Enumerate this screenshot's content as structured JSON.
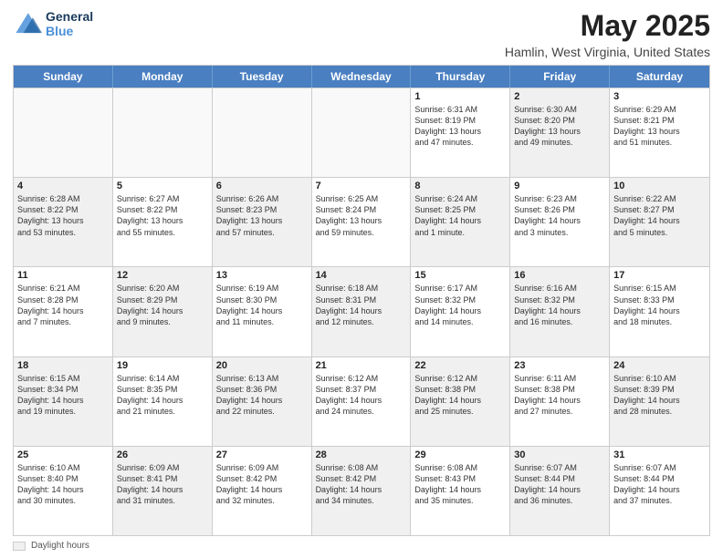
{
  "logo": {
    "line1": "General",
    "line2": "Blue"
  },
  "title": "May 2025",
  "subtitle": "Hamlin, West Virginia, United States",
  "weekdays": [
    "Sunday",
    "Monday",
    "Tuesday",
    "Wednesday",
    "Thursday",
    "Friday",
    "Saturday"
  ],
  "footer_label": "Daylight hours",
  "rows": [
    [
      {
        "day": "",
        "info": [],
        "empty": true
      },
      {
        "day": "",
        "info": [],
        "empty": true
      },
      {
        "day": "",
        "info": [],
        "empty": true
      },
      {
        "day": "",
        "info": [],
        "empty": true
      },
      {
        "day": "1",
        "info": [
          "Sunrise: 6:31 AM",
          "Sunset: 8:19 PM",
          "Daylight: 13 hours",
          "and 47 minutes."
        ]
      },
      {
        "day": "2",
        "info": [
          "Sunrise: 6:30 AM",
          "Sunset: 8:20 PM",
          "Daylight: 13 hours",
          "and 49 minutes."
        ],
        "shaded": true
      },
      {
        "day": "3",
        "info": [
          "Sunrise: 6:29 AM",
          "Sunset: 8:21 PM",
          "Daylight: 13 hours",
          "and 51 minutes."
        ]
      }
    ],
    [
      {
        "day": "4",
        "info": [
          "Sunrise: 6:28 AM",
          "Sunset: 8:22 PM",
          "Daylight: 13 hours",
          "and 53 minutes."
        ],
        "shaded": true
      },
      {
        "day": "5",
        "info": [
          "Sunrise: 6:27 AM",
          "Sunset: 8:22 PM",
          "Daylight: 13 hours",
          "and 55 minutes."
        ]
      },
      {
        "day": "6",
        "info": [
          "Sunrise: 6:26 AM",
          "Sunset: 8:23 PM",
          "Daylight: 13 hours",
          "and 57 minutes."
        ],
        "shaded": true
      },
      {
        "day": "7",
        "info": [
          "Sunrise: 6:25 AM",
          "Sunset: 8:24 PM",
          "Daylight: 13 hours",
          "and 59 minutes."
        ]
      },
      {
        "day": "8",
        "info": [
          "Sunrise: 6:24 AM",
          "Sunset: 8:25 PM",
          "Daylight: 14 hours",
          "and 1 minute."
        ],
        "shaded": true
      },
      {
        "day": "9",
        "info": [
          "Sunrise: 6:23 AM",
          "Sunset: 8:26 PM",
          "Daylight: 14 hours",
          "and 3 minutes."
        ]
      },
      {
        "day": "10",
        "info": [
          "Sunrise: 6:22 AM",
          "Sunset: 8:27 PM",
          "Daylight: 14 hours",
          "and 5 minutes."
        ],
        "shaded": true
      }
    ],
    [
      {
        "day": "11",
        "info": [
          "Sunrise: 6:21 AM",
          "Sunset: 8:28 PM",
          "Daylight: 14 hours",
          "and 7 minutes."
        ]
      },
      {
        "day": "12",
        "info": [
          "Sunrise: 6:20 AM",
          "Sunset: 8:29 PM",
          "Daylight: 14 hours",
          "and 9 minutes."
        ],
        "shaded": true
      },
      {
        "day": "13",
        "info": [
          "Sunrise: 6:19 AM",
          "Sunset: 8:30 PM",
          "Daylight: 14 hours",
          "and 11 minutes."
        ]
      },
      {
        "day": "14",
        "info": [
          "Sunrise: 6:18 AM",
          "Sunset: 8:31 PM",
          "Daylight: 14 hours",
          "and 12 minutes."
        ],
        "shaded": true
      },
      {
        "day": "15",
        "info": [
          "Sunrise: 6:17 AM",
          "Sunset: 8:32 PM",
          "Daylight: 14 hours",
          "and 14 minutes."
        ]
      },
      {
        "day": "16",
        "info": [
          "Sunrise: 6:16 AM",
          "Sunset: 8:32 PM",
          "Daylight: 14 hours",
          "and 16 minutes."
        ],
        "shaded": true
      },
      {
        "day": "17",
        "info": [
          "Sunrise: 6:15 AM",
          "Sunset: 8:33 PM",
          "Daylight: 14 hours",
          "and 18 minutes."
        ]
      }
    ],
    [
      {
        "day": "18",
        "info": [
          "Sunrise: 6:15 AM",
          "Sunset: 8:34 PM",
          "Daylight: 14 hours",
          "and 19 minutes."
        ],
        "shaded": true
      },
      {
        "day": "19",
        "info": [
          "Sunrise: 6:14 AM",
          "Sunset: 8:35 PM",
          "Daylight: 14 hours",
          "and 21 minutes."
        ]
      },
      {
        "day": "20",
        "info": [
          "Sunrise: 6:13 AM",
          "Sunset: 8:36 PM",
          "Daylight: 14 hours",
          "and 22 minutes."
        ],
        "shaded": true
      },
      {
        "day": "21",
        "info": [
          "Sunrise: 6:12 AM",
          "Sunset: 8:37 PM",
          "Daylight: 14 hours",
          "and 24 minutes."
        ]
      },
      {
        "day": "22",
        "info": [
          "Sunrise: 6:12 AM",
          "Sunset: 8:38 PM",
          "Daylight: 14 hours",
          "and 25 minutes."
        ],
        "shaded": true
      },
      {
        "day": "23",
        "info": [
          "Sunrise: 6:11 AM",
          "Sunset: 8:38 PM",
          "Daylight: 14 hours",
          "and 27 minutes."
        ]
      },
      {
        "day": "24",
        "info": [
          "Sunrise: 6:10 AM",
          "Sunset: 8:39 PM",
          "Daylight: 14 hours",
          "and 28 minutes."
        ],
        "shaded": true
      }
    ],
    [
      {
        "day": "25",
        "info": [
          "Sunrise: 6:10 AM",
          "Sunset: 8:40 PM",
          "Daylight: 14 hours",
          "and 30 minutes."
        ]
      },
      {
        "day": "26",
        "info": [
          "Sunrise: 6:09 AM",
          "Sunset: 8:41 PM",
          "Daylight: 14 hours",
          "and 31 minutes."
        ],
        "shaded": true
      },
      {
        "day": "27",
        "info": [
          "Sunrise: 6:09 AM",
          "Sunset: 8:42 PM",
          "Daylight: 14 hours",
          "and 32 minutes."
        ]
      },
      {
        "day": "28",
        "info": [
          "Sunrise: 6:08 AM",
          "Sunset: 8:42 PM",
          "Daylight: 14 hours",
          "and 34 minutes."
        ],
        "shaded": true
      },
      {
        "day": "29",
        "info": [
          "Sunrise: 6:08 AM",
          "Sunset: 8:43 PM",
          "Daylight: 14 hours",
          "and 35 minutes."
        ]
      },
      {
        "day": "30",
        "info": [
          "Sunrise: 6:07 AM",
          "Sunset: 8:44 PM",
          "Daylight: 14 hours",
          "and 36 minutes."
        ],
        "shaded": true
      },
      {
        "day": "31",
        "info": [
          "Sunrise: 6:07 AM",
          "Sunset: 8:44 PM",
          "Daylight: 14 hours",
          "and 37 minutes."
        ]
      }
    ]
  ]
}
